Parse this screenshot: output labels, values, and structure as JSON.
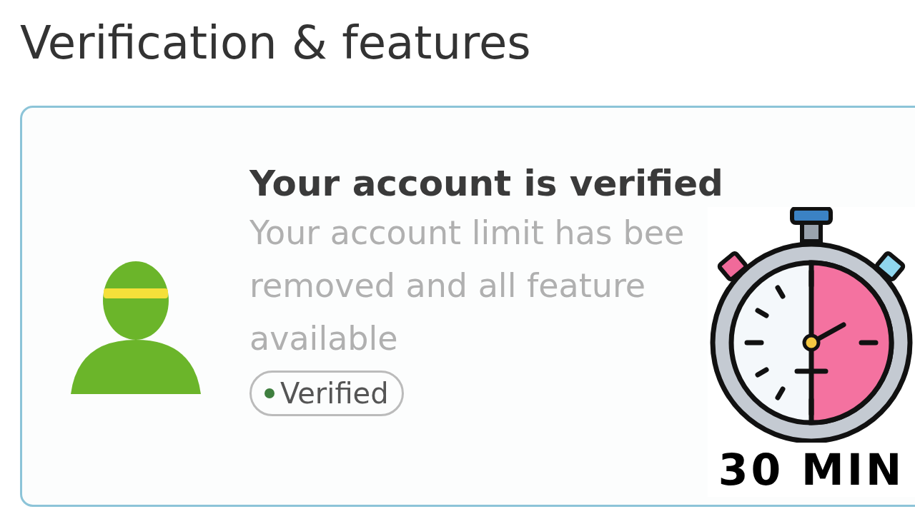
{
  "page": {
    "title": "Verification & features"
  },
  "card": {
    "title": "Your account is verified",
    "description_lines": [
      "Your account limit has bee",
      "removed and all feature",
      "available"
    ],
    "badge": {
      "label": "Verified",
      "color": "#3f7f3f"
    }
  },
  "overlay": {
    "label": "30 MIN"
  }
}
